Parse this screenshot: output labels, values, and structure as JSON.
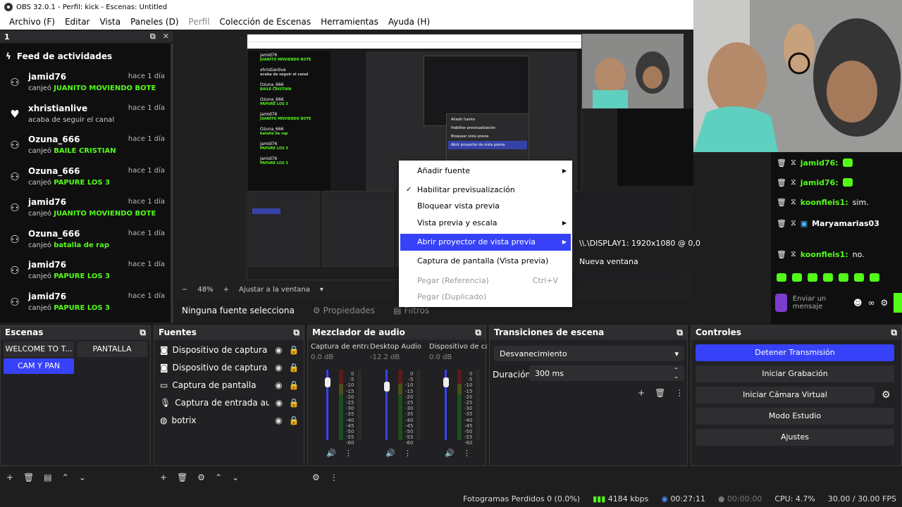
{
  "window": {
    "title": "OBS 32.0.1 - Perfil: kick - Escenas: Untitled"
  },
  "menu": [
    "Archivo (F)",
    "Editar",
    "Vista",
    "Paneles (D)",
    "Perfil",
    "Colección de Escenas",
    "Herramientas",
    "Ayuda (H)"
  ],
  "dock_top": {
    "label": "1"
  },
  "feed": {
    "title": "Feed de actividades",
    "items": [
      {
        "user": "jamid76",
        "time": "hace 1 día",
        "prefix": "canjeó",
        "reward": "JUANITO MOVIENDO BOTE",
        "icon": "reward-icon"
      },
      {
        "user": "xhristianlive",
        "time": "hace 1 día",
        "prefix": "acaba de seguir el canal",
        "reward": "",
        "icon": "heart-icon"
      },
      {
        "user": "Ozuna_666",
        "time": "hace 1 día",
        "prefix": "canjeó",
        "reward": "BAILE CRISTIAN",
        "icon": "reward-icon"
      },
      {
        "user": "Ozuna_666",
        "time": "hace 1 día",
        "prefix": "canjeó",
        "reward": "PAPURE LOS 3",
        "icon": "reward-icon"
      },
      {
        "user": "jamid76",
        "time": "hace 1 día",
        "prefix": "canjeó",
        "reward": "JUANITO MOVIENDO BOTE",
        "icon": "reward-icon"
      },
      {
        "user": "Ozuna_666",
        "time": "hace 1 día",
        "prefix": "canjeó",
        "reward": "batalla de rap",
        "icon": "reward-icon"
      },
      {
        "user": "jamid76",
        "time": "hace 1 día",
        "prefix": "canjeó",
        "reward": "PAPURE LOS 3",
        "icon": "reward-icon"
      },
      {
        "user": "jamid76",
        "time": "hace 1 día",
        "prefix": "canjeó",
        "reward": "PAPURE LOS 3",
        "icon": "reward-icon"
      }
    ]
  },
  "preview": {
    "zoom": "48%",
    "fit": "Ajustar a la ventana"
  },
  "context_menu": {
    "items": [
      {
        "label": "Añadir fuente",
        "checked": false,
        "submenu": true,
        "highlight": false,
        "disabled": false,
        "shortcut": ""
      },
      {
        "label": "Habilitar previsualización",
        "checked": true,
        "submenu": false,
        "highlight": false,
        "disabled": false,
        "shortcut": ""
      },
      {
        "label": "Bloquear vista previa",
        "checked": false,
        "submenu": false,
        "highlight": false,
        "disabled": false,
        "shortcut": ""
      },
      {
        "label": "Vista previa y escala",
        "checked": false,
        "submenu": true,
        "highlight": false,
        "disabled": false,
        "shortcut": ""
      },
      {
        "label": "Abrir proyector de vista previa",
        "checked": false,
        "submenu": true,
        "highlight": true,
        "disabled": false,
        "shortcut": ""
      },
      {
        "label": "Captura de pantalla (Vista previa)",
        "checked": false,
        "submenu": false,
        "highlight": false,
        "disabled": false,
        "shortcut": ""
      },
      {
        "label": "Pegar (Referencia)",
        "checked": false,
        "submenu": false,
        "highlight": false,
        "disabled": true,
        "shortcut": "Ctrl+V"
      },
      {
        "label": "Pegar (Duplicado)",
        "checked": false,
        "submenu": false,
        "highlight": false,
        "disabled": true,
        "shortcut": ""
      }
    ],
    "submenu": [
      "\\\\.\\DISPLAY1: 1920x1080 @ 0,0",
      "Nueva ventana"
    ]
  },
  "chat": {
    "rows": [
      {
        "user": "jamid76:",
        "msg": ""
      },
      {
        "user": "jamid76:",
        "msg": ""
      },
      {
        "user": "koonfleis1:",
        "msg": "sim."
      },
      {
        "user": "Maryamarias03",
        "msg": ""
      },
      {
        "user": "koonfleis1:",
        "msg": "no."
      }
    ],
    "placeholder": "Enviar un mensaje"
  },
  "source_bar": {
    "status": "Ninguna fuente selecciona",
    "props": "Propiedades",
    "filters": "Filtros"
  },
  "scenes": {
    "title": "Escenas",
    "items": [
      "WELCOME TO T...",
      "PANTALLA",
      "CAM Y PAN"
    ],
    "selected": 2
  },
  "sources": {
    "title": "Fuentes",
    "items": [
      "Dispositivo de captura de v",
      "Dispositivo de captura de v",
      "Captura de pantalla",
      "Captura de entrada audio",
      "botrix"
    ]
  },
  "mixer": {
    "title": "Mezclador de audio",
    "channels": [
      {
        "name": "Captura de entrada",
        "db": "0.0 dB",
        "level": 0.62
      },
      {
        "name": "Desktop Audio",
        "db": "-12.2 dB",
        "level": 0.42
      },
      {
        "name": "Dispositivo de capt",
        "db": "0.0 dB",
        "level": 0.62
      }
    ],
    "scale": [
      "0",
      "-5",
      "-10",
      "-15",
      "-20",
      "-25",
      "-30",
      "-35",
      "-40",
      "-45",
      "-50",
      "-55",
      "-60"
    ]
  },
  "transitions": {
    "title": "Transiciones de escena",
    "selected": "Desvanecimiento",
    "duration_label": "Duración",
    "duration": "300 ms"
  },
  "controls": {
    "title": "Controles",
    "buttons": [
      "Detener Transmisión",
      "Iniciar Grabación",
      "Iniciar Cámara Virtual",
      "Modo Estudio",
      "Ajustes"
    ],
    "active": 0
  },
  "status": {
    "frames": "Fotogramas Perdidos 0 (0.0%)",
    "bitrate": "4184 kbps",
    "stream_time": "00:27:11",
    "rec_time": "00:00:00",
    "cpu": "CPU: 4.7%",
    "fps": "30.00 / 30.00 FPS"
  },
  "colors": {
    "accent": "#3742f8",
    "kick_green": "#53fc18"
  }
}
